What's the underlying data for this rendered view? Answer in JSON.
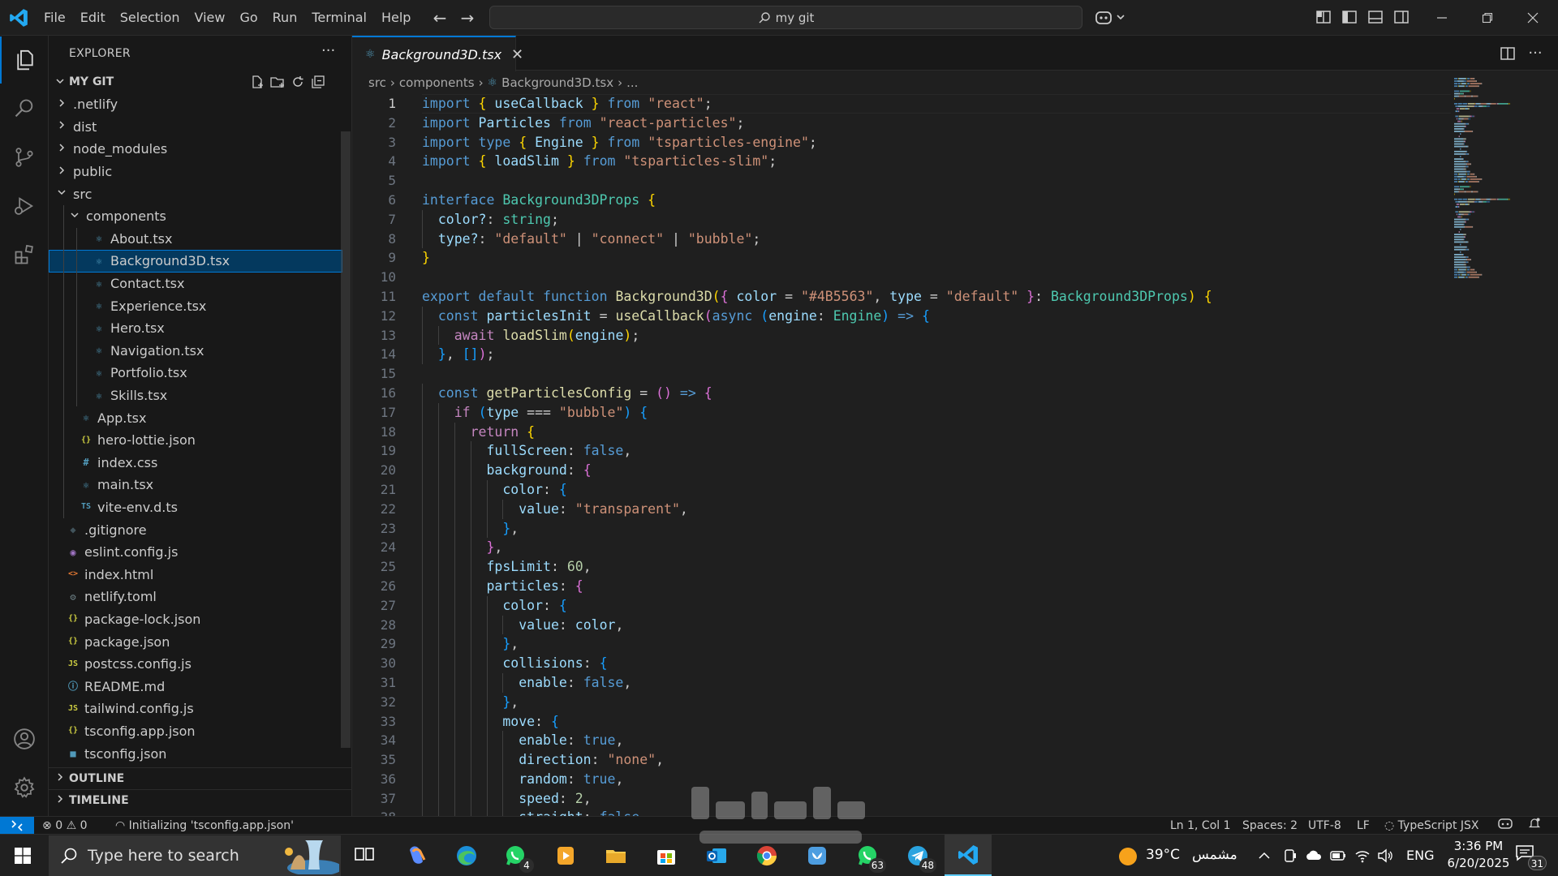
{
  "titlebar": {
    "menus": [
      "File",
      "Edit",
      "Selection",
      "View",
      "Go",
      "Run",
      "Terminal",
      "Help"
    ],
    "search_text": "my git"
  },
  "explorer": {
    "title": "EXPLORER",
    "more": "···",
    "root": "MY GIT",
    "tree": [
      {
        "label": ".netlify",
        "type": "folder",
        "depth": 0,
        "expanded": false
      },
      {
        "label": "dist",
        "type": "folder",
        "depth": 0,
        "expanded": false
      },
      {
        "label": "node_modules",
        "type": "folder",
        "depth": 0,
        "expanded": false
      },
      {
        "label": "public",
        "type": "folder",
        "depth": 0,
        "expanded": false
      },
      {
        "label": "src",
        "type": "folder",
        "depth": 0,
        "expanded": true
      },
      {
        "label": "components",
        "type": "folder",
        "depth": 1,
        "expanded": true
      },
      {
        "label": "About.tsx",
        "type": "react",
        "depth": 2
      },
      {
        "label": "Background3D.tsx",
        "type": "react",
        "depth": 2,
        "selected": true
      },
      {
        "label": "Contact.tsx",
        "type": "react",
        "depth": 2
      },
      {
        "label": "Experience.tsx",
        "type": "react",
        "depth": 2
      },
      {
        "label": "Hero.tsx",
        "type": "react",
        "depth": 2
      },
      {
        "label": "Navigation.tsx",
        "type": "react",
        "depth": 2
      },
      {
        "label": "Portfolio.tsx",
        "type": "react",
        "depth": 2
      },
      {
        "label": "Skills.tsx",
        "type": "react",
        "depth": 2
      },
      {
        "label": "App.tsx",
        "type": "react",
        "depth": 1
      },
      {
        "label": "hero-lottie.json",
        "type": "json",
        "depth": 1
      },
      {
        "label": "index.css",
        "type": "css",
        "depth": 1
      },
      {
        "label": "main.tsx",
        "type": "react",
        "depth": 1
      },
      {
        "label": "vite-env.d.ts",
        "type": "ts",
        "depth": 1
      },
      {
        "label": ".gitignore",
        "type": "git",
        "depth": 0
      },
      {
        "label": "eslint.config.js",
        "type": "eslint",
        "depth": 0
      },
      {
        "label": "index.html",
        "type": "html",
        "depth": 0
      },
      {
        "label": "netlify.toml",
        "type": "gear",
        "depth": 0
      },
      {
        "label": "package-lock.json",
        "type": "json",
        "depth": 0
      },
      {
        "label": "package.json",
        "type": "json",
        "depth": 0
      },
      {
        "label": "postcss.config.js",
        "type": "js",
        "depth": 0
      },
      {
        "label": "README.md",
        "type": "info",
        "depth": 0
      },
      {
        "label": "tailwind.config.js",
        "type": "js",
        "depth": 0
      },
      {
        "label": "tsconfig.app.json",
        "type": "json",
        "depth": 0
      },
      {
        "label": "tsconfig.json",
        "type": "tsconfig",
        "depth": 0
      }
    ],
    "outline": "OUTLINE",
    "timeline": "TIMELINE"
  },
  "icons": {
    "react": {
      "glyph": "⚛",
      "color": "#519aba"
    },
    "json": {
      "glyph": "{}",
      "color": "#cbcb41"
    },
    "css": {
      "glyph": "#",
      "color": "#519aba"
    },
    "ts": {
      "glyph": "TS",
      "color": "#519aba"
    },
    "git": {
      "glyph": "◆",
      "color": "#41535b"
    },
    "eslint": {
      "glyph": "◉",
      "color": "#a074c4"
    },
    "html": {
      "glyph": "<>",
      "color": "#e37933"
    },
    "gear": {
      "glyph": "⚙",
      "color": "#6d8086"
    },
    "js": {
      "glyph": "JS",
      "color": "#cbcb41"
    },
    "info": {
      "glyph": "ⓘ",
      "color": "#519aba"
    },
    "tsconfig": {
      "glyph": "■",
      "color": "#519aba"
    }
  },
  "editor": {
    "tab_label": "Background3D.tsx",
    "breadcrumb": [
      "src",
      "components",
      "Background3D.tsx",
      "..."
    ],
    "current_line": 1,
    "lines": [
      [
        [
          "import",
          "kw"
        ],
        [
          " ",
          ""
        ],
        [
          "{",
          "br1"
        ],
        [
          " useCallback ",
          "var"
        ],
        [
          "}",
          "br1"
        ],
        [
          " ",
          ""
        ],
        [
          "from",
          "kw"
        ],
        [
          " ",
          ""
        ],
        [
          "\"react\"",
          "str"
        ],
        [
          ";",
          "punct"
        ]
      ],
      [
        [
          "import",
          "kw"
        ],
        [
          " Particles ",
          "var"
        ],
        [
          "from",
          "kw"
        ],
        [
          " ",
          ""
        ],
        [
          "\"react-particles\"",
          "str"
        ],
        [
          ";",
          "punct"
        ]
      ],
      [
        [
          "import",
          "kw"
        ],
        [
          " ",
          ""
        ],
        [
          "type",
          "kw"
        ],
        [
          " ",
          ""
        ],
        [
          "{",
          "br1"
        ],
        [
          " Engine ",
          "var"
        ],
        [
          "}",
          "br1"
        ],
        [
          " ",
          ""
        ],
        [
          "from",
          "kw"
        ],
        [
          " ",
          ""
        ],
        [
          "\"tsparticles-engine\"",
          "str"
        ],
        [
          ";",
          "punct"
        ]
      ],
      [
        [
          "import",
          "kw"
        ],
        [
          " ",
          ""
        ],
        [
          "{",
          "br1"
        ],
        [
          " loadSlim ",
          "var"
        ],
        [
          "}",
          "br1"
        ],
        [
          " ",
          ""
        ],
        [
          "from",
          "kw"
        ],
        [
          " ",
          ""
        ],
        [
          "\"tsparticles-slim\"",
          "str"
        ],
        [
          ";",
          "punct"
        ]
      ],
      [],
      [
        [
          "interface",
          "kw"
        ],
        [
          " ",
          ""
        ],
        [
          "Background3DProps",
          "type"
        ],
        [
          " ",
          ""
        ],
        [
          "{",
          "br1"
        ]
      ],
      [
        [
          "  color?",
          "var"
        ],
        [
          ": ",
          "punct"
        ],
        [
          "string",
          "type"
        ],
        [
          ";",
          "punct"
        ]
      ],
      [
        [
          "  type?",
          "var"
        ],
        [
          ": ",
          "punct"
        ],
        [
          "\"default\"",
          "str"
        ],
        [
          " | ",
          "punct"
        ],
        [
          "\"connect\"",
          "str"
        ],
        [
          " | ",
          "punct"
        ],
        [
          "\"bubble\"",
          "str"
        ],
        [
          ";",
          "punct"
        ]
      ],
      [
        [
          "}",
          "br1"
        ]
      ],
      [],
      [
        [
          "export",
          "kw"
        ],
        [
          " ",
          ""
        ],
        [
          "default",
          "kw"
        ],
        [
          " ",
          ""
        ],
        [
          "function",
          "kw"
        ],
        [
          " ",
          ""
        ],
        [
          "Background3D",
          "fn"
        ],
        [
          "(",
          "br1"
        ],
        [
          "{",
          "br2"
        ],
        [
          " color ",
          "var"
        ],
        [
          "= ",
          "punct"
        ],
        [
          "\"#4B5563\"",
          "str"
        ],
        [
          ", ",
          "punct"
        ],
        [
          "type ",
          "var"
        ],
        [
          "= ",
          "punct"
        ],
        [
          "\"default\"",
          "str"
        ],
        [
          " ",
          "punct"
        ],
        [
          "}",
          "br2"
        ],
        [
          ": ",
          "punct"
        ],
        [
          "Background3DProps",
          "type"
        ],
        [
          ")",
          "br1"
        ],
        [
          " ",
          ""
        ],
        [
          "{",
          "br1"
        ]
      ],
      [
        [
          "  ",
          ""
        ],
        [
          "const",
          "kw"
        ],
        [
          " particlesInit ",
          "var"
        ],
        [
          "= ",
          "punct"
        ],
        [
          "useCallback",
          "fn"
        ],
        [
          "(",
          "br2"
        ],
        [
          "async",
          "kw"
        ],
        [
          " ",
          ""
        ],
        [
          "(",
          "br3"
        ],
        [
          "engine",
          "var"
        ],
        [
          ": ",
          "punct"
        ],
        [
          "Engine",
          "type"
        ],
        [
          ")",
          "br3"
        ],
        [
          " ",
          ""
        ],
        [
          "=>",
          "kw"
        ],
        [
          " ",
          ""
        ],
        [
          "{",
          "br3"
        ]
      ],
      [
        [
          "    ",
          ""
        ],
        [
          "await",
          "ctl"
        ],
        [
          " ",
          ""
        ],
        [
          "loadSlim",
          "fn"
        ],
        [
          "(",
          "br1"
        ],
        [
          "engine",
          "var"
        ],
        [
          ")",
          "br1"
        ],
        [
          ";",
          "punct"
        ]
      ],
      [
        [
          "  ",
          ""
        ],
        [
          "}",
          "br3"
        ],
        [
          ", ",
          "punct"
        ],
        [
          "[]",
          "br3"
        ],
        [
          ")",
          "br2"
        ],
        [
          ";",
          "punct"
        ]
      ],
      [],
      [
        [
          "  ",
          ""
        ],
        [
          "const",
          "kw"
        ],
        [
          " ",
          ""
        ],
        [
          "getParticlesConfig",
          "fn"
        ],
        [
          " = ",
          "punct"
        ],
        [
          "()",
          "br2"
        ],
        [
          " ",
          ""
        ],
        [
          "=>",
          "kw"
        ],
        [
          " ",
          ""
        ],
        [
          "{",
          "br2"
        ]
      ],
      [
        [
          "    ",
          ""
        ],
        [
          "if",
          "ctl"
        ],
        [
          " ",
          ""
        ],
        [
          "(",
          "br3"
        ],
        [
          "type",
          "var"
        ],
        [
          " === ",
          "punct"
        ],
        [
          "\"bubble\"",
          "str"
        ],
        [
          ")",
          "br3"
        ],
        [
          " ",
          ""
        ],
        [
          "{",
          "br3"
        ]
      ],
      [
        [
          "      ",
          ""
        ],
        [
          "return",
          "ctl"
        ],
        [
          " ",
          ""
        ],
        [
          "{",
          "br1"
        ]
      ],
      [
        [
          "        fullScreen",
          "var"
        ],
        [
          ": ",
          "punct"
        ],
        [
          "false",
          "kw"
        ],
        [
          ",",
          "punct"
        ]
      ],
      [
        [
          "        background",
          "var"
        ],
        [
          ": ",
          "punct"
        ],
        [
          "{",
          "br2"
        ]
      ],
      [
        [
          "          color",
          "var"
        ],
        [
          ": ",
          "punct"
        ],
        [
          "{",
          "br3"
        ]
      ],
      [
        [
          "            value",
          "var"
        ],
        [
          ": ",
          "punct"
        ],
        [
          "\"transparent\"",
          "str"
        ],
        [
          ",",
          "punct"
        ]
      ],
      [
        [
          "          ",
          ""
        ],
        [
          "}",
          "br3"
        ],
        [
          ",",
          "punct"
        ]
      ],
      [
        [
          "        ",
          ""
        ],
        [
          "}",
          "br2"
        ],
        [
          ",",
          "punct"
        ]
      ],
      [
        [
          "        fpsLimit",
          "var"
        ],
        [
          ": ",
          "punct"
        ],
        [
          "60",
          "num"
        ],
        [
          ",",
          "punct"
        ]
      ],
      [
        [
          "        particles",
          "var"
        ],
        [
          ": ",
          "punct"
        ],
        [
          "{",
          "br2"
        ]
      ],
      [
        [
          "          color",
          "var"
        ],
        [
          ": ",
          "punct"
        ],
        [
          "{",
          "br3"
        ]
      ],
      [
        [
          "            value",
          "var"
        ],
        [
          ": ",
          "punct"
        ],
        [
          "color",
          "var"
        ],
        [
          ",",
          "punct"
        ]
      ],
      [
        [
          "          ",
          ""
        ],
        [
          "}",
          "br3"
        ],
        [
          ",",
          "punct"
        ]
      ],
      [
        [
          "          collisions",
          "var"
        ],
        [
          ": ",
          "punct"
        ],
        [
          "{",
          "br3"
        ]
      ],
      [
        [
          "            enable",
          "var"
        ],
        [
          ": ",
          "punct"
        ],
        [
          "false",
          "kw"
        ],
        [
          ",",
          "punct"
        ]
      ],
      [
        [
          "          ",
          ""
        ],
        [
          "}",
          "br3"
        ],
        [
          ",",
          "punct"
        ]
      ],
      [
        [
          "          move",
          "var"
        ],
        [
          ": ",
          "punct"
        ],
        [
          "{",
          "br3"
        ]
      ],
      [
        [
          "            enable",
          "var"
        ],
        [
          ": ",
          "punct"
        ],
        [
          "true",
          "kw"
        ],
        [
          ",",
          "punct"
        ]
      ],
      [
        [
          "            direction",
          "var"
        ],
        [
          ": ",
          "punct"
        ],
        [
          "\"none\"",
          "str"
        ],
        [
          ",",
          "punct"
        ]
      ],
      [
        [
          "            random",
          "var"
        ],
        [
          ": ",
          "punct"
        ],
        [
          "true",
          "kw"
        ],
        [
          ",",
          "punct"
        ]
      ],
      [
        [
          "            speed",
          "var"
        ],
        [
          ": ",
          "punct"
        ],
        [
          "2",
          "num"
        ],
        [
          ",",
          "punct"
        ]
      ],
      [
        [
          "            straight",
          "var"
        ],
        [
          ": ",
          "punct"
        ],
        [
          "false",
          "kw"
        ],
        [
          ",",
          "punct"
        ]
      ]
    ]
  },
  "statusbar": {
    "errors": "0",
    "warnings": "0",
    "task": "Initializing 'tsconfig.app.json'",
    "position": "Ln 1, Col 1",
    "spaces": "Spaces: 2",
    "encoding": "UTF-8",
    "eol": "LF",
    "language": "TypeScript JSX"
  },
  "taskbar": {
    "search_placeholder": "Type here to search",
    "apps": [
      {
        "name": "task-view",
        "badge": ""
      },
      {
        "name": "copilot",
        "badge": ""
      },
      {
        "name": "edge",
        "badge": ""
      },
      {
        "name": "whatsapp",
        "badge": "4"
      },
      {
        "name": "media-player",
        "badge": ""
      },
      {
        "name": "file-explorer",
        "badge": ""
      },
      {
        "name": "microsoft-store",
        "badge": ""
      },
      {
        "name": "outlook",
        "badge": ""
      },
      {
        "name": "chrome",
        "badge": ""
      },
      {
        "name": "bluesky",
        "badge": ""
      },
      {
        "name": "whatsapp-2",
        "badge": "63"
      },
      {
        "name": "telegram",
        "badge": "48"
      },
      {
        "name": "vscode",
        "badge": ""
      }
    ],
    "weather_temp": "39°C",
    "weather_label": "مشمس",
    "language": "ENG",
    "time": "3:36 PM",
    "date": "6/20/2025",
    "notifications": "31"
  },
  "colors": {
    "accent": "#0078d4",
    "selection": "#04395e",
    "tab_active_border": "#0078d4"
  }
}
